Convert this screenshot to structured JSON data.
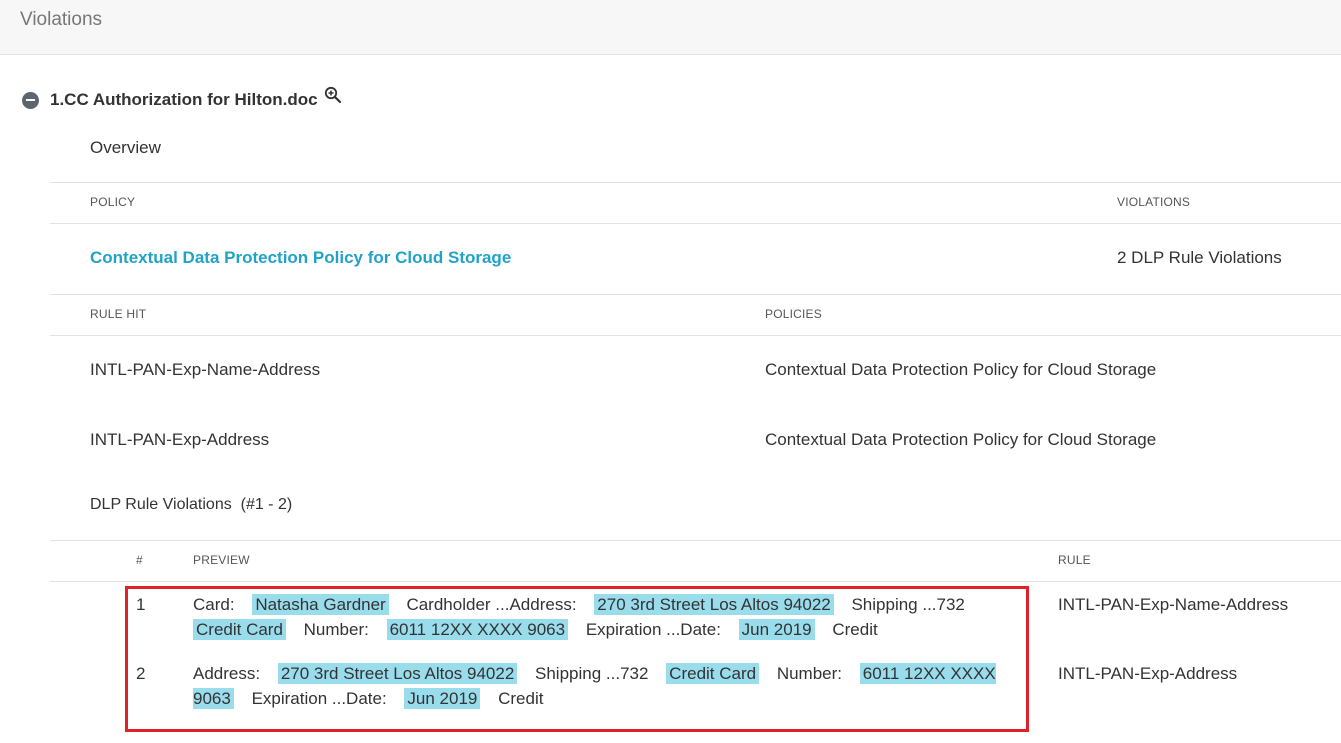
{
  "header": {
    "title": "Violations"
  },
  "document": {
    "title": "1.CC Authorization for Hilton.doc"
  },
  "overview": {
    "label": "Overview"
  },
  "policy_table": {
    "col_policy": "POLICY",
    "col_violations": "VIOLATIONS",
    "policy_name": "Contextual Data Protection Policy for Cloud Storage",
    "violations": "2 DLP Rule Violations"
  },
  "rules_table": {
    "col_rule_hit": "RULE HIT",
    "col_policies": "POLICIES",
    "rows": [
      {
        "rule": "INTL-PAN-Exp-Name-Address",
        "policy": "Contextual Data Protection Policy for Cloud Storage"
      },
      {
        "rule": "INTL-PAN-Exp-Address",
        "policy": "Contextual Data Protection Policy for Cloud Storage"
      }
    ]
  },
  "dlp_section": {
    "title": "DLP Rule Violations",
    "range": "(#1 - 2)",
    "col_num": "#",
    "col_preview": "PREVIEW",
    "col_rule": "RULE",
    "rows": [
      {
        "num": "1",
        "rule": "INTL-PAN-Exp-Name-Address",
        "segments": [
          {
            "text": "Card:",
            "highlight": false
          },
          {
            "text": "Natasha Gardner",
            "highlight": true
          },
          {
            "text": "Cardholder ...Address:",
            "highlight": false
          },
          {
            "text": "270 3rd Street Los Altos 94022",
            "highlight": true
          },
          {
            "text": "Shipping ...732",
            "highlight": false
          },
          {
            "text": "Credit Card",
            "highlight": true
          },
          {
            "text": "Number:",
            "highlight": false
          },
          {
            "text": "6011 12XX XXXX 9063",
            "highlight": true
          },
          {
            "text": "Expiration ...Date:",
            "highlight": false
          },
          {
            "text": "Jun 2019",
            "highlight": true
          },
          {
            "text": "Credit",
            "highlight": false
          }
        ]
      },
      {
        "num": "2",
        "rule": "INTL-PAN-Exp-Address",
        "segments": [
          {
            "text": "Address:",
            "highlight": false
          },
          {
            "text": "270 3rd Street Los Altos 94022",
            "highlight": true
          },
          {
            "text": "Shipping ...732",
            "highlight": false
          },
          {
            "text": "Credit Card",
            "highlight": true
          },
          {
            "text": "Number:",
            "highlight": false
          },
          {
            "text": "6011 12XX XXXX 9063",
            "highlight": true
          },
          {
            "text": "Expiration ...Date:",
            "highlight": false
          },
          {
            "text": "Jun 2019",
            "highlight": true
          },
          {
            "text": "Credit",
            "highlight": false
          }
        ]
      }
    ]
  },
  "colors": {
    "link": "#21a3c8",
    "highlight": "#99dcec",
    "annotation_box": "#e02127"
  },
  "icons": {
    "collapse": "minus-circle-icon",
    "zoom": "zoom-in-icon"
  }
}
